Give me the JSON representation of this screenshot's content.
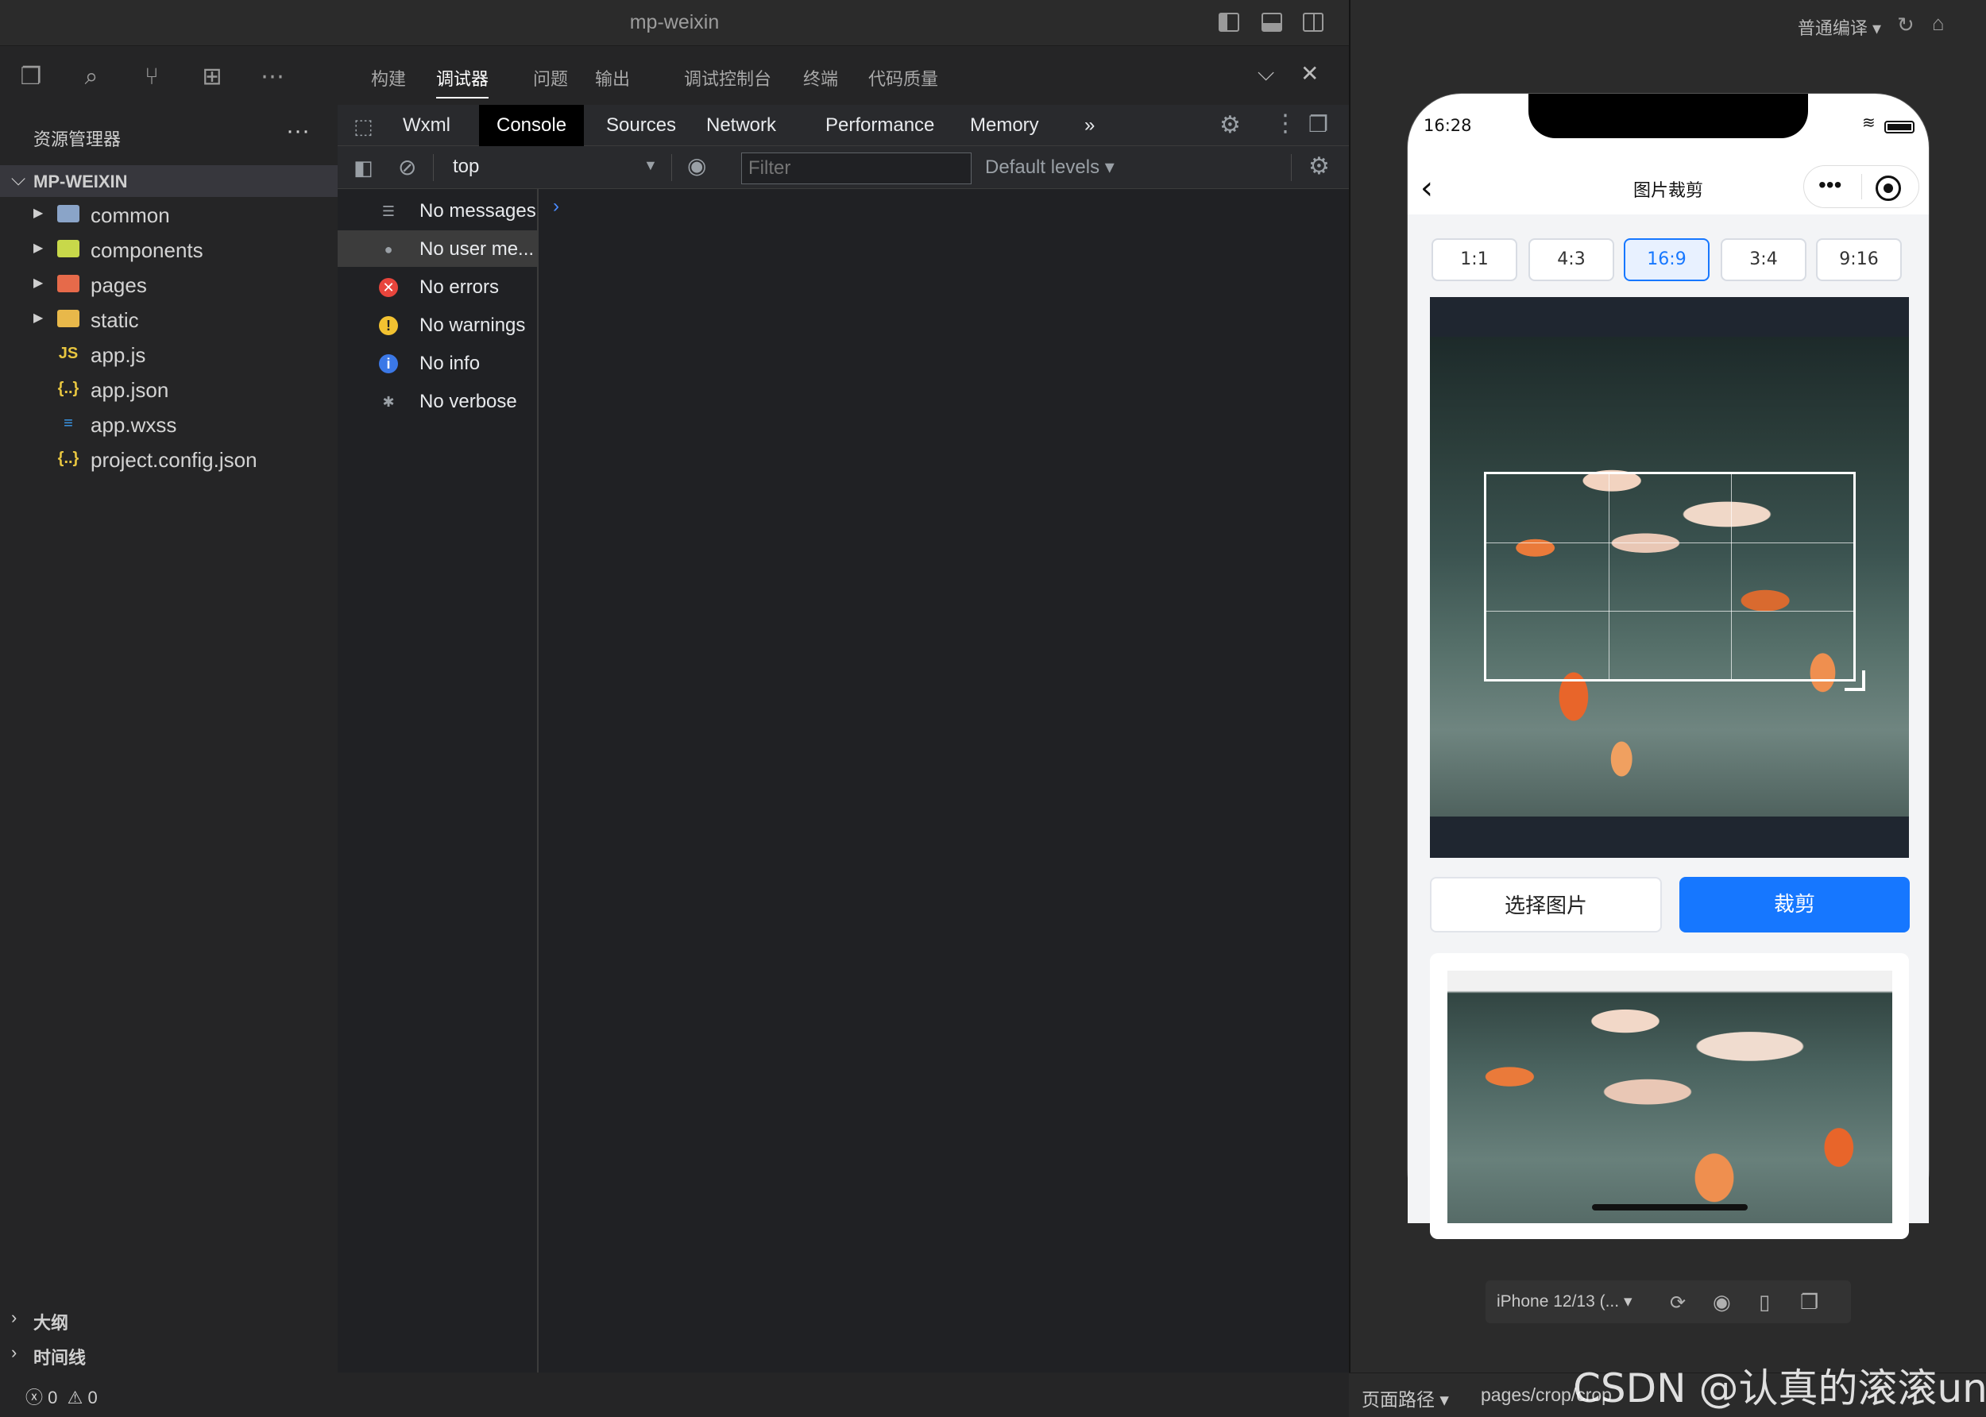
{
  "window": {
    "title": "mp-weixin"
  },
  "simulator_top": {
    "compile_mode": "普通编译 ▾"
  },
  "sidebar": {
    "header": "资源管理器",
    "more": "···",
    "project": "MP-WEIXIN",
    "items": [
      {
        "label": "common",
        "type": "folder",
        "icon_color": "#8aa4c8"
      },
      {
        "label": "components",
        "type": "folder",
        "icon_color": "#c8d84a"
      },
      {
        "label": "pages",
        "type": "folder",
        "icon_color": "#e66a4a"
      },
      {
        "label": "static",
        "type": "folder",
        "icon_color": "#e8b84a"
      },
      {
        "label": "app.js",
        "type": "file",
        "icon": "JS",
        "icon_color": "#e8c640"
      },
      {
        "label": "app.json",
        "type": "file",
        "icon": "{..}",
        "icon_color": "#e8c640"
      },
      {
        "label": "app.wxss",
        "type": "file",
        "icon": "≡",
        "icon_color": "#3b9cf0"
      },
      {
        "label": "project.config.json",
        "type": "file",
        "icon": "{..}",
        "icon_color": "#e8c640"
      }
    ],
    "outline": "大纲",
    "timeline": "时间线"
  },
  "panel_tabs": [
    "构建",
    "调试器",
    "问题",
    "输出",
    "调试控制台",
    "终端",
    "代码质量"
  ],
  "panel_active": "调试器",
  "devtools": {
    "tabs": [
      "Wxml",
      "Console",
      "Sources",
      "Network",
      "Performance",
      "Memory"
    ],
    "active": "Console",
    "more": "»",
    "context": "top",
    "filter_placeholder": "Filter",
    "levels": "Default levels ▾"
  },
  "console_sidebar": [
    {
      "label": "No messages",
      "icon": "list-icon"
    },
    {
      "label": "No user me...",
      "icon": "user-icon"
    },
    {
      "label": "No errors",
      "icon": "error-icon"
    },
    {
      "label": "No warnings",
      "icon": "warning-icon"
    },
    {
      "label": "No info",
      "icon": "info-icon"
    },
    {
      "label": "No verbose",
      "icon": "bug-icon"
    }
  ],
  "console_prompt": "›",
  "statusbar": {
    "errors": "0",
    "warnings": "0"
  },
  "phone": {
    "time": "16:28",
    "nav_title": "图片裁剪",
    "ratios": [
      "1:1",
      "4:3",
      "16:9",
      "3:4",
      "9:16"
    ],
    "active_ratio": "16:9",
    "choose_button": "选择图片",
    "crop_button": "裁剪",
    "accent_color": "#1677ff"
  },
  "simulator_bottom": {
    "device": "iPhone 12/13 (... ▾"
  },
  "path_bar": {
    "label": "页面路径 ▾",
    "path": "pages/crop/crop"
  },
  "watermark": "CSDN @认真的滚滚una"
}
